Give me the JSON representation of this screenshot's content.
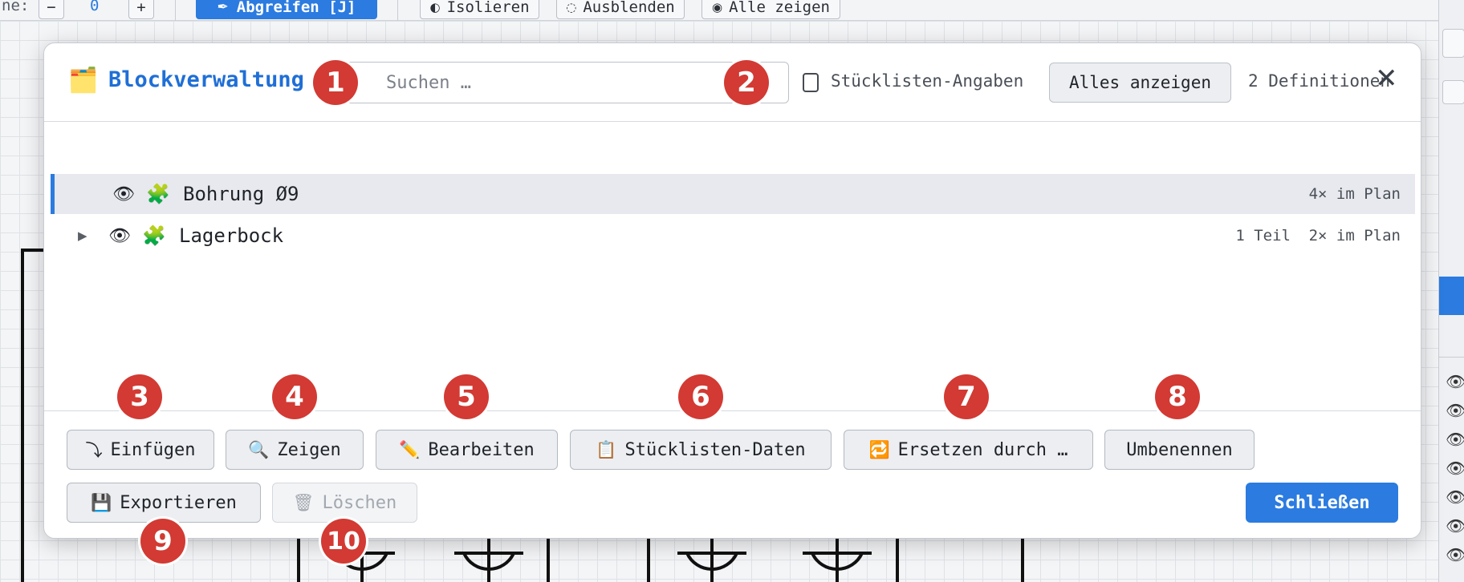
{
  "toolbar": {
    "partial_label": "ne:",
    "minus": "−",
    "value": "0",
    "plus": "+",
    "grab_label": "Abgreifen [J]",
    "isolate_label": "Isolieren",
    "hide_label": "Ausblenden",
    "show_all_label": "Alle zeigen"
  },
  "dialog": {
    "title": "Blockverwaltung",
    "search_placeholder": "Suchen …",
    "bom_checkbox_label": "Stücklisten-Angaben",
    "show_all_button": "Alles anzeigen",
    "definition_count": "2 Definitionen",
    "close_symbol": "✕"
  },
  "blocks": [
    {
      "name": "Bohrung Ø9",
      "parts": "",
      "uses": "4× im Plan",
      "selected": true,
      "expandable": false
    },
    {
      "name": "Lagerbock",
      "parts": "1 Teil",
      "uses": "2× im Plan",
      "selected": false,
      "expandable": true
    }
  ],
  "actions": {
    "insert": "Einfügen",
    "show": "Zeigen",
    "edit": "Bearbeiten",
    "bom_data": "Stücklisten-Daten",
    "replace": "Ersetzen durch …",
    "rename": "Umbenennen",
    "export": "Exportieren",
    "delete": "Löschen",
    "close": "Schließen"
  },
  "markers": [
    "1",
    "2",
    "3",
    "4",
    "5",
    "6",
    "7",
    "8",
    "9",
    "10"
  ],
  "colors": {
    "accent": "#2b7be0",
    "title": "#1f6fd6",
    "marker": "#d23a33"
  },
  "icons": {
    "folder": "folder-icon",
    "eye": "eye-icon",
    "puzzle": "puzzle-icon",
    "insert": "insert-arrow-icon",
    "search": "magnifier-icon",
    "edit": "pencil-icon",
    "bom": "clipboard-icon",
    "replace": "repeat-icon",
    "export": "floppy-icon",
    "delete": "trash-icon"
  }
}
